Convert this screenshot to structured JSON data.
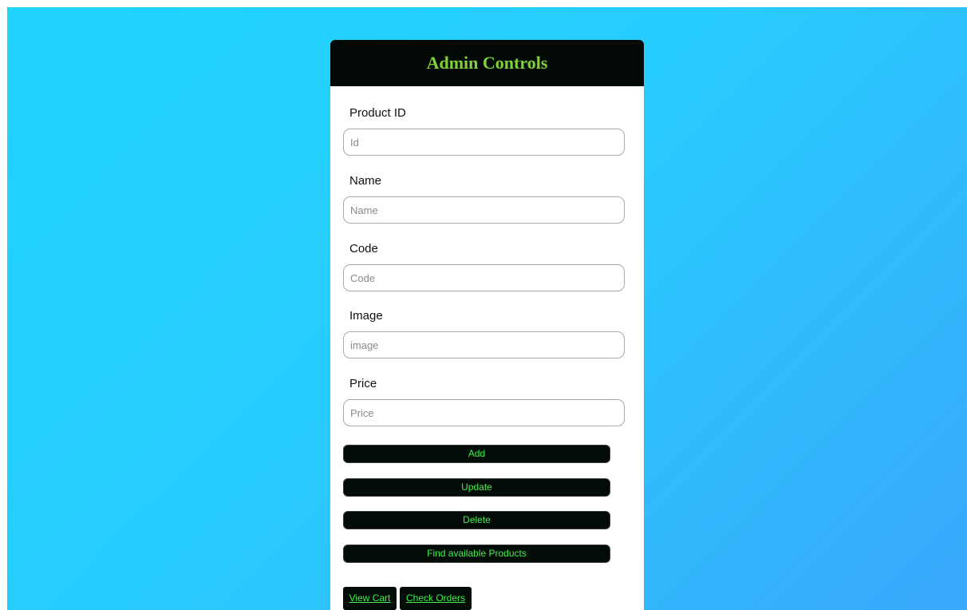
{
  "header": {
    "title": "Admin Controls"
  },
  "form": {
    "fields": [
      {
        "label": "Product ID",
        "placeholder": "Id",
        "value": ""
      },
      {
        "label": "Name",
        "placeholder": "Name",
        "value": ""
      },
      {
        "label": "Code",
        "placeholder": "Code",
        "value": ""
      },
      {
        "label": "Image",
        "placeholder": "image",
        "value": ""
      },
      {
        "label": "Price",
        "placeholder": "Price",
        "value": ""
      }
    ]
  },
  "actions": {
    "add": "Add",
    "update": "Update",
    "delete": "Delete",
    "find": "Find available Products"
  },
  "links": {
    "view_cart": "View Cart",
    "check_orders": "Check Orders"
  },
  "colors": {
    "background_gradient_start": "#21d4fd",
    "background_gradient_end": "#3aa8fb",
    "header_bg": "#030a06",
    "title_color": "#7fd23a",
    "button_bg": "#030c06",
    "button_text": "#3ff24a"
  }
}
